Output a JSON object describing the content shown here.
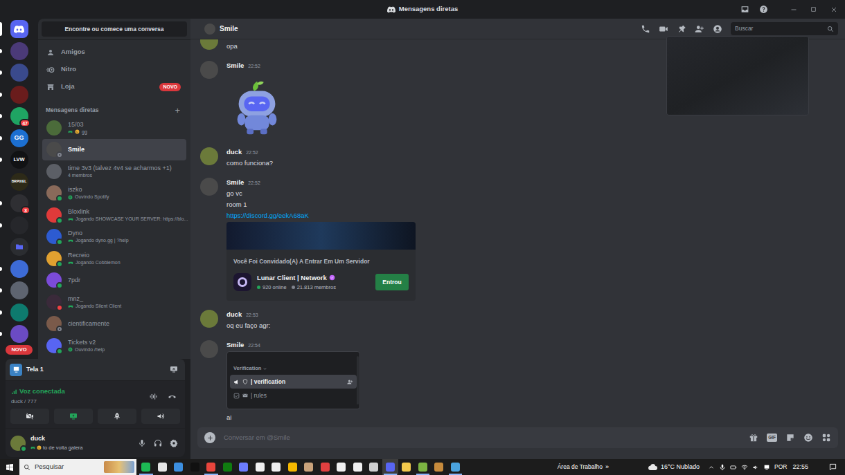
{
  "window": {
    "title": "Mensagens diretas"
  },
  "servers": {
    "items": [
      {
        "kind": "home",
        "label": "",
        "color": "#5865f2",
        "selected": true,
        "unread": false,
        "badge": ""
      },
      {
        "kind": "server",
        "label": "",
        "color": "#4b3a78",
        "selected": false,
        "unread": true,
        "badge": ""
      },
      {
        "kind": "server",
        "label": "",
        "color": "#3a4a8c",
        "selected": false,
        "unread": true,
        "badge": ""
      },
      {
        "kind": "server",
        "label": "",
        "color": "#6a1c1c",
        "selected": false,
        "unread": true,
        "badge": ""
      },
      {
        "kind": "server",
        "label": "",
        "color": "#1fa463",
        "selected": false,
        "unread": true,
        "badge": "47"
      },
      {
        "kind": "server",
        "label": "GG",
        "color": "#1c6fd1",
        "selected": false,
        "unread": true,
        "badge": ""
      },
      {
        "kind": "server",
        "label": "LVW",
        "color": "#111214",
        "selected": false,
        "unread": true,
        "badge": ""
      },
      {
        "kind": "server",
        "label": "BRPIXEL",
        "color": "#2d2a18",
        "selected": false,
        "unread": false,
        "badge": ""
      },
      {
        "kind": "server",
        "label": "",
        "color": "#2f2f33",
        "selected": false,
        "unread": true,
        "badge": "3"
      },
      {
        "kind": "server",
        "label": "",
        "color": "#26272b",
        "selected": false,
        "unread": true,
        "badge": ""
      },
      {
        "kind": "folder",
        "label": "",
        "color": "#5865f2",
        "selected": false,
        "unread": false,
        "badge": ""
      },
      {
        "kind": "server",
        "label": "",
        "color": "#3d6bd6",
        "selected": false,
        "unread": true,
        "badge": ""
      },
      {
        "kind": "server",
        "label": "",
        "color": "#5e6470",
        "selected": false,
        "unread": true,
        "badge": ""
      },
      {
        "kind": "server",
        "label": "",
        "color": "#0e7a6e",
        "selected": false,
        "unread": true,
        "badge": ""
      },
      {
        "kind": "server",
        "label": "",
        "color": "#6b4bc4",
        "selected": false,
        "unread": true,
        "badge": ""
      }
    ],
    "new_badge": "NOVO"
  },
  "dm_sidebar": {
    "search": "Encontre ou comece uma conversa",
    "nav": [
      {
        "kind": "friends",
        "label": "Amigos",
        "badge": ""
      },
      {
        "kind": "nitro",
        "label": "Nitro",
        "badge": ""
      },
      {
        "kind": "shop",
        "label": "Loja",
        "badge": "NOVO"
      }
    ],
    "section": "Mensagens diretas",
    "add": "+",
    "conversations": [
      {
        "name": "15/03",
        "activity": "gg",
        "kind": "custom",
        "status": "none",
        "color": "#4b6b3a",
        "selected": false
      },
      {
        "name": "Smile",
        "activity": "",
        "kind": "none",
        "status": "offline",
        "color": "#4a4a4a",
        "selected": true
      },
      {
        "name": "time 3v3 (talvez 4v4 se acharmos +1)",
        "activity": "4 membros",
        "kind": "members",
        "status": "none",
        "color": "#5c5f66",
        "selected": false
      },
      {
        "name": "iszko",
        "activity": "Ouvindo Spotify",
        "kind": "listening",
        "status": "online",
        "color": "#8a6a5a",
        "selected": false
      },
      {
        "name": "Bloxlink",
        "activity": "Jogando SHOWCASE YOUR SERVER: https://blo...",
        "kind": "playing",
        "status": "online",
        "color": "#e03a3a",
        "selected": false
      },
      {
        "name": "Dyno",
        "activity": "Jogando dyno.gg | ?help",
        "kind": "playing",
        "status": "online",
        "color": "#2d5bd1",
        "selected": false
      },
      {
        "name": "Recreio",
        "activity": "Jogando Cobblemon",
        "kind": "playing",
        "status": "online",
        "color": "#e0a030",
        "selected": false
      },
      {
        "name": "7pdr",
        "activity": "",
        "kind": "none",
        "status": "online",
        "color": "#7b4bd8",
        "selected": false
      },
      {
        "name": "mnz_",
        "activity": "Jogando Silent Client",
        "kind": "playing",
        "status": "dnd",
        "color": "#3a2a3a",
        "selected": false
      },
      {
        "name": "cientificamente",
        "activity": "",
        "kind": "none",
        "status": "offline",
        "color": "#7a5a4a",
        "selected": false
      },
      {
        "name": "Tickets v2",
        "activity": "Ouvindo /help",
        "kind": "listening",
        "status": "online",
        "color": "#5865f2",
        "selected": false
      }
    ]
  },
  "voice_panel": {
    "stream": {
      "title": "Tela 1"
    },
    "status": "Voz conectada",
    "channel": "duck / 777",
    "controls": [
      {
        "kind": "camera",
        "on": false
      },
      {
        "kind": "screen",
        "on": true
      },
      {
        "kind": "activities",
        "on": false
      },
      {
        "kind": "soundboard",
        "on": false
      }
    ]
  },
  "user_panel": {
    "name": "duck",
    "status": "to de volta galera",
    "presence": "online",
    "color": "#6b7a3a"
  },
  "chat": {
    "header": {
      "name": "Smile",
      "search": "Buscar",
      "color": "#4a4a4a"
    },
    "messages": [
      {
        "kind": "cut",
        "color": "#6b7a3a",
        "lines": [
          {
            "kind": "text",
            "text": "opa"
          }
        ]
      },
      {
        "kind": "group",
        "author": "Smile",
        "time": "22:52",
        "color": "#4a4a4a",
        "lines": [
          {
            "kind": "sticker"
          }
        ]
      },
      {
        "kind": "group",
        "author": "duck",
        "time": "22:52",
        "color": "#6b7a3a",
        "lines": [
          {
            "kind": "text",
            "text": "como funciona?"
          }
        ]
      },
      {
        "kind": "group",
        "author": "Smile",
        "time": "22:52",
        "color": "#4a4a4a",
        "lines": [
          {
            "kind": "text",
            "text": "go vc"
          },
          {
            "kind": "text",
            "text": "room 1"
          },
          {
            "kind": "link",
            "text": "https://discord.gg/eekA68aK"
          },
          {
            "kind": "invite",
            "heading": "Você Foi Convidado(A) A Entrar Em Um Servidor",
            "server": "Lunar Client | Network",
            "online": "920 online",
            "members": "21.813 membros",
            "button": "Entrou"
          }
        ]
      },
      {
        "kind": "group",
        "author": "duck",
        "time": "22:53",
        "color": "#6b7a3a",
        "lines": [
          {
            "kind": "text",
            "text": "oq eu faço agr:"
          }
        ]
      },
      {
        "kind": "group",
        "author": "Smile",
        "time": "22:54",
        "color": "#4a4a4a",
        "lines": [
          {
            "kind": "image",
            "category": "Verification",
            "channels": [
              {
                "name": "| verification",
                "kind": "announcement",
                "selected": true
              },
              {
                "name": "| rules",
                "kind": "rules",
                "selected": false
              }
            ]
          },
          {
            "kind": "text",
            "text": "ai"
          }
        ]
      }
    ],
    "composer": {
      "placeholder": "Conversar em @Smile",
      "gif": "GIF"
    }
  },
  "taskbar": {
    "search": "Pesquisar",
    "apps": [
      {
        "color": "#1db954",
        "running": true,
        "selected": false
      },
      {
        "color": "#e6e6e6",
        "running": false,
        "selected": false
      },
      {
        "color": "#3c8fe0",
        "running": false,
        "selected": false
      },
      {
        "color": "#111111",
        "running": false,
        "selected": false
      },
      {
        "color": "#e8453c",
        "running": true,
        "selected": false
      },
      {
        "color": "#107c10",
        "running": false,
        "selected": false
      },
      {
        "color": "#6b7cff",
        "running": false,
        "selected": false
      },
      {
        "color": "#f0f0f0",
        "running": false,
        "selected": false
      },
      {
        "color": "#f0f0f0",
        "running": false,
        "selected": false
      },
      {
        "color": "#f5b800",
        "running": false,
        "selected": false
      },
      {
        "color": "#c9a27a",
        "running": false,
        "selected": false
      },
      {
        "color": "#e04040",
        "running": false,
        "selected": false
      },
      {
        "color": "#f0f0f0",
        "running": false,
        "selected": false
      },
      {
        "color": "#f0f0f0",
        "running": false,
        "selected": false
      },
      {
        "color": "#d0d0d0",
        "running": false,
        "selected": false
      },
      {
        "color": "#5865f2",
        "running": true,
        "selected": true
      },
      {
        "color": "#f2c94c",
        "running": false,
        "selected": false
      },
      {
        "color": "#7cb342",
        "running": true,
        "selected": false
      },
      {
        "color": "#c68a3c",
        "running": false,
        "selected": false
      },
      {
        "color": "#4aa3df",
        "running": true,
        "selected": false
      }
    ],
    "desktop": "Área de Trabalho",
    "chevron": "»",
    "weather": "16°C Nublado",
    "language": "POR",
    "time": "22:55"
  }
}
